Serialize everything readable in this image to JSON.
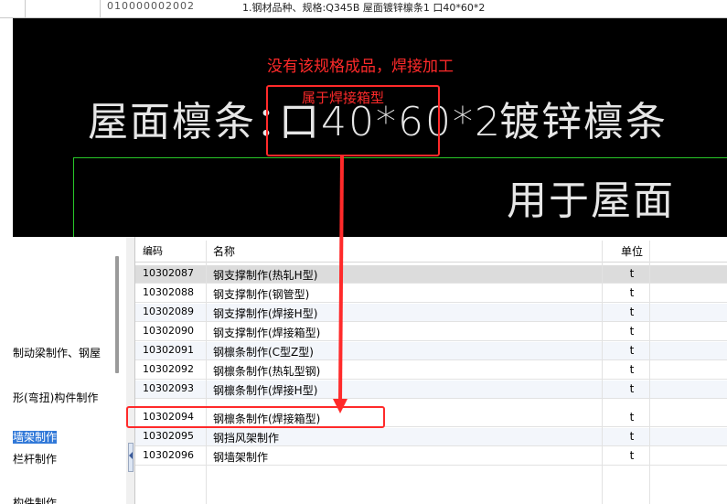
{
  "top_strip": {
    "code_fragment": "010000002002",
    "description": "1.钢材品种、规格:Q345B 屋面镀锌檩条1 口40*60*2"
  },
  "cad": {
    "note": "没有该规格成品，焊接加工",
    "text_main_left": "屋面檩条：",
    "text_spec": "口40*60*2",
    "text_right": "镀锌檩条",
    "text_lower": "用于屋面",
    "box_label": "属于焊接箱型",
    "annotation_color": "#ff2a2a",
    "line_color": "#28c728"
  },
  "left_panel": {
    "items": [
      "制动梁制作、钢屋",
      "形(弯扭)构件制作",
      "墙架制作",
      "栏杆制作",
      "构件制作"
    ],
    "selected_item": "墙架制作"
  },
  "table": {
    "headers": {
      "code": "编码",
      "name": "名称",
      "unit": "单位"
    },
    "rows": [
      {
        "code": "10302087",
        "name": "钢支撑制作(热轧H型)",
        "unit": "t"
      },
      {
        "code": "10302088",
        "name": "钢支撑制作(钢管型)",
        "unit": "t"
      },
      {
        "code": "10302089",
        "name": "钢支撑制作(焊接H型)",
        "unit": "t"
      },
      {
        "code": "10302090",
        "name": "钢支撑制作(焊接箱型)",
        "unit": "t"
      },
      {
        "code": "10302091",
        "name": "钢檩条制作(C型Z型)",
        "unit": "t"
      },
      {
        "code": "10302092",
        "name": "钢檩条制作(热轧型钢)",
        "unit": "t"
      },
      {
        "code": "10302093",
        "name": "钢檩条制作(焊接H型)",
        "unit": "t"
      },
      {
        "code": "10302094",
        "name": "钢檩条制作(焊接箱型)",
        "unit": "t"
      },
      {
        "code": "10302095",
        "name": "钢挡风架制作",
        "unit": "t"
      },
      {
        "code": "10302096",
        "name": "钢墙架制作",
        "unit": "t"
      }
    ],
    "highlighted_code": "10302094"
  }
}
